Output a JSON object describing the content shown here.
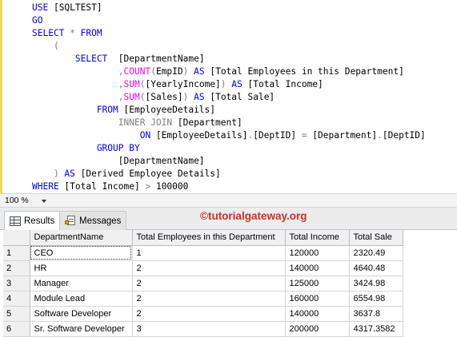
{
  "editor": {
    "lines": [
      [
        {
          "t": "USE ",
          "c": "kw"
        },
        {
          "t": "[SQLTEST]",
          "c": "plain"
        }
      ],
      [
        {
          "t": "GO",
          "c": "kw"
        }
      ],
      [
        {
          "t": "SELECT ",
          "c": "kw"
        },
        {
          "t": "* ",
          "c": "gray"
        },
        {
          "t": "FROM",
          "c": "kw"
        }
      ],
      [
        {
          "t": "    (",
          "c": "gray"
        }
      ],
      [
        {
          "t": "        SELECT  ",
          "c": "kw"
        },
        {
          "t": "[DepartmentName]",
          "c": "plain"
        }
      ],
      [
        {
          "t": "                ,",
          "c": "gray"
        },
        {
          "t": "COUNT",
          "c": "fn"
        },
        {
          "t": "(",
          "c": "gray"
        },
        {
          "t": "EmpID",
          "c": "plain"
        },
        {
          "t": ") ",
          "c": "gray"
        },
        {
          "t": "AS ",
          "c": "kw"
        },
        {
          "t": "[Total Employees in this Department]",
          "c": "plain"
        }
      ],
      [
        {
          "t": "                ,",
          "c": "gray"
        },
        {
          "t": "SUM",
          "c": "fn"
        },
        {
          "t": "(",
          "c": "gray"
        },
        {
          "t": "[YearlyIncome]",
          "c": "plain"
        },
        {
          "t": ") ",
          "c": "gray"
        },
        {
          "t": "AS ",
          "c": "kw"
        },
        {
          "t": "[Total Income]",
          "c": "plain"
        }
      ],
      [
        {
          "t": "                ,",
          "c": "gray"
        },
        {
          "t": "SUM",
          "c": "fn"
        },
        {
          "t": "(",
          "c": "gray"
        },
        {
          "t": "[Sales]",
          "c": "plain"
        },
        {
          "t": ") ",
          "c": "gray"
        },
        {
          "t": "AS ",
          "c": "kw"
        },
        {
          "t": "[Total Sale]",
          "c": "plain"
        }
      ],
      [
        {
          "t": "            FROM ",
          "c": "kw"
        },
        {
          "t": "[EmployeeDetails]",
          "c": "plain"
        }
      ],
      [
        {
          "t": "                INNER JOIN ",
          "c": "gray"
        },
        {
          "t": "[Department]",
          "c": "plain"
        }
      ],
      [
        {
          "t": "                    ON ",
          "c": "kw"
        },
        {
          "t": "[EmployeeDetails]",
          "c": "plain"
        },
        {
          "t": ".",
          "c": "gray"
        },
        {
          "t": "[DeptID] ",
          "c": "plain"
        },
        {
          "t": "= ",
          "c": "gray"
        },
        {
          "t": "[Department]",
          "c": "plain"
        },
        {
          "t": ".",
          "c": "gray"
        },
        {
          "t": "[DeptID]",
          "c": "plain"
        }
      ],
      [
        {
          "t": "            GROUP BY",
          "c": "kw"
        }
      ],
      [
        {
          "t": "                [DepartmentName]",
          "c": "plain"
        }
      ],
      [
        {
          "t": "    ) ",
          "c": "gray"
        },
        {
          "t": "AS ",
          "c": "kw"
        },
        {
          "t": "[Derived Employee Details]",
          "c": "plain"
        }
      ],
      [
        {
          "t": "WHERE ",
          "c": "kw"
        },
        {
          "t": "[Total Income] ",
          "c": "plain"
        },
        {
          "t": "> ",
          "c": "gray"
        },
        {
          "t": "100000",
          "c": "plain"
        }
      ]
    ]
  },
  "zoom": {
    "value": "100 %"
  },
  "tabs": {
    "results_label": "Results",
    "messages_label": "Messages"
  },
  "watermark": "©tutorialgateway.org",
  "grid": {
    "columns": [
      "",
      "DepartmentName",
      "Total Employees in this Department",
      "Total Income",
      "Total Sale"
    ],
    "rows": [
      [
        "1",
        "CEO",
        "1",
        "120000",
        "2320.49"
      ],
      [
        "2",
        "HR",
        "2",
        "140000",
        "4640.48"
      ],
      [
        "3",
        "Manager",
        "2",
        "125000",
        "3424.98"
      ],
      [
        "4",
        "Module Lead",
        "2",
        "160000",
        "6554.98"
      ],
      [
        "5",
        "Software Developer",
        "2",
        "140000",
        "3637.8"
      ],
      [
        "6",
        "Sr. Software Developer",
        "3",
        "200000",
        "4317.3582"
      ]
    ]
  },
  "colors": {
    "keyword": "#0000ff",
    "function": "#ff00ff",
    "operator": "#808080",
    "watermark": "#c8322c"
  }
}
